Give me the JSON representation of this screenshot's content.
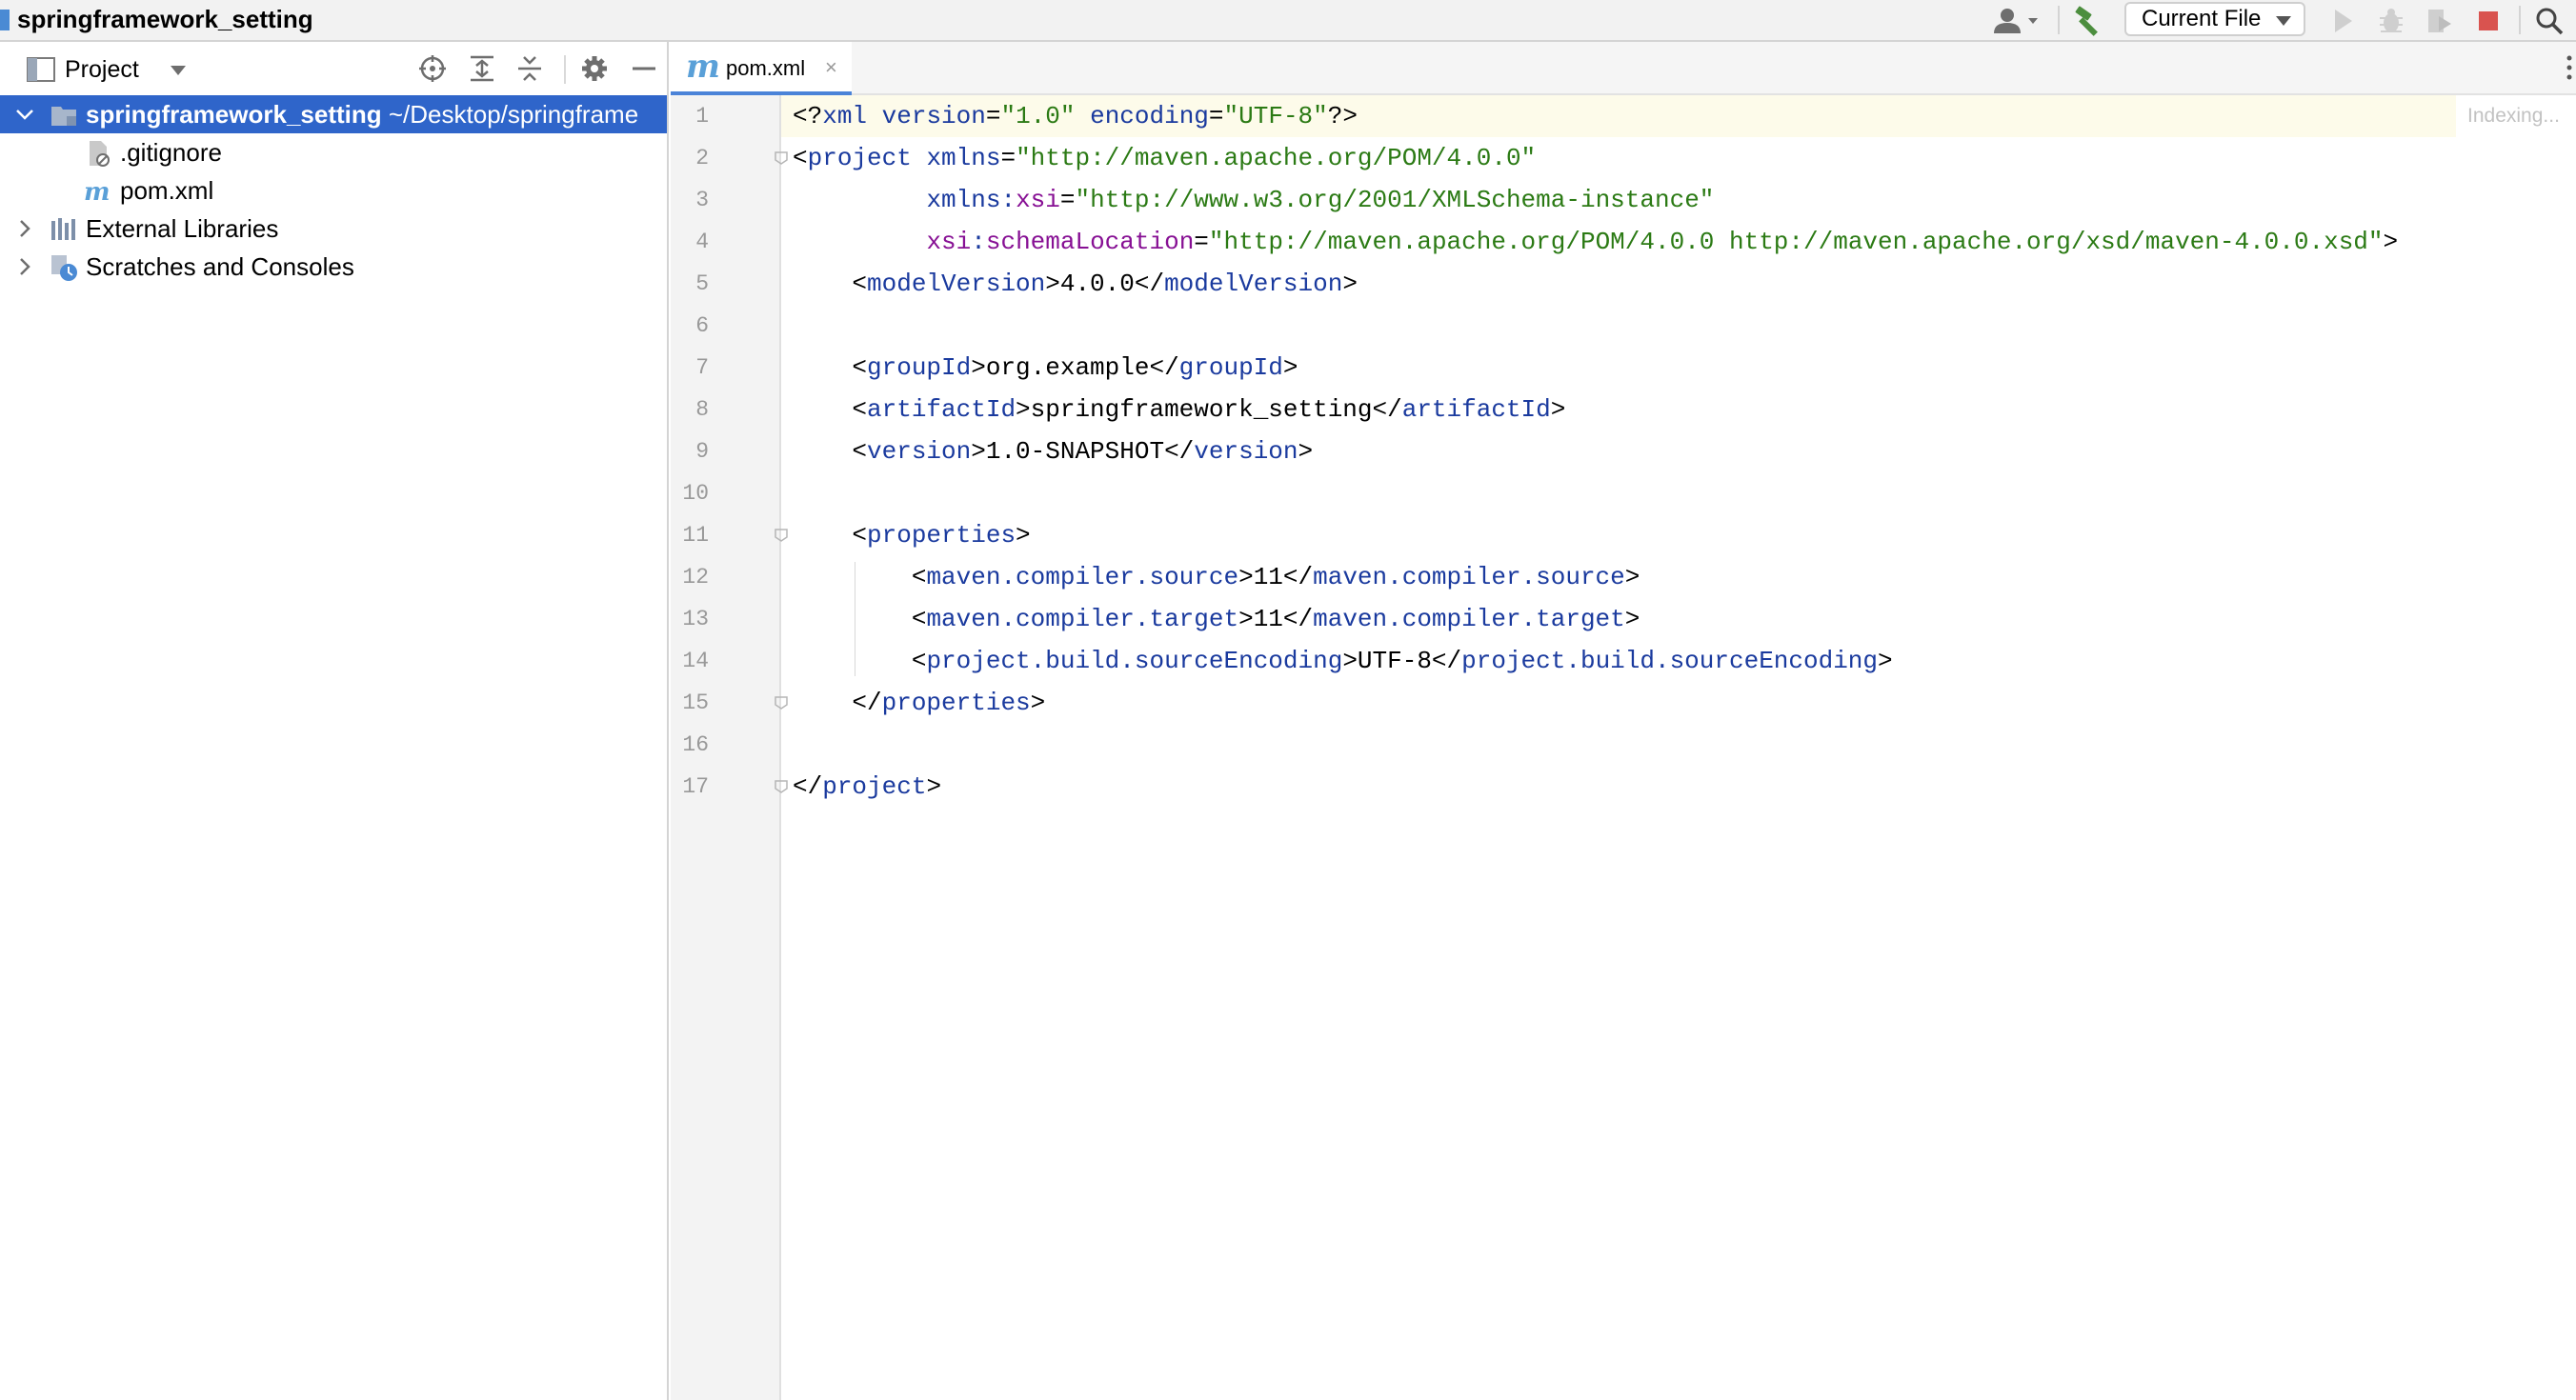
{
  "window": {
    "title": "springframework_setting"
  },
  "toolbar": {
    "run_config": "Current File",
    "icons": [
      "user-icon",
      "hammer-icon",
      "run-icon",
      "debug-icon",
      "coverage-icon",
      "stop-icon",
      "search-icon"
    ]
  },
  "project_panel": {
    "title": "Project",
    "tree": [
      {
        "label": "springframework_setting",
        "path": "~/Desktop/springframe",
        "icon": "folder-icon",
        "expanded": true,
        "selected": true
      },
      {
        "label": ".gitignore",
        "icon": "gitignore-file-icon"
      },
      {
        "label": "pom.xml",
        "icon": "maven-file-icon"
      },
      {
        "label": "External Libraries",
        "icon": "libraries-icon",
        "expanded": false
      },
      {
        "label": "Scratches and Consoles",
        "icon": "scratches-icon",
        "expanded": false
      }
    ]
  },
  "editor": {
    "tab": {
      "label": "pom.xml",
      "close": "×"
    },
    "status": "Indexing...",
    "current_line": 1,
    "line_numbers": [
      "1",
      "2",
      "3",
      "4",
      "5",
      "6",
      "7",
      "8",
      "9",
      "10",
      "11",
      "12",
      "13",
      "14",
      "15",
      "16",
      "17"
    ],
    "lines": [
      "<?xml version=\"1.0\" encoding=\"UTF-8\"?>",
      "<project xmlns=\"http://maven.apache.org/POM/4.0.0\"",
      "         xmlns:xsi=\"http://www.w3.org/2001/XMLSchema-instance\"",
      "         xsi:schemaLocation=\"http://maven.apache.org/POM/4.0.0 http://maven.apache.org/xsd/maven-4.0.0.xsd\">",
      "    <modelVersion>4.0.0</modelVersion>",
      "",
      "    <groupId>org.example</groupId>",
      "    <artifactId>springframework_setting</artifactId>",
      "    <version>1.0-SNAPSHOT</version>",
      "",
      "    <properties>",
      "        <maven.compiler.source>11</maven.compiler.source>",
      "        <maven.compiler.target>11</maven.compiler.target>",
      "        <project.build.sourceEncoding>UTF-8</project.build.sourceEncoding>",
      "    </properties>",
      "",
      "</project>"
    ]
  },
  "colors": {
    "selection": "#2f65ca",
    "tag": "#1a3a9e",
    "string": "#2b7a14",
    "namespace": "#871094",
    "current_line": "#fdfbea"
  }
}
